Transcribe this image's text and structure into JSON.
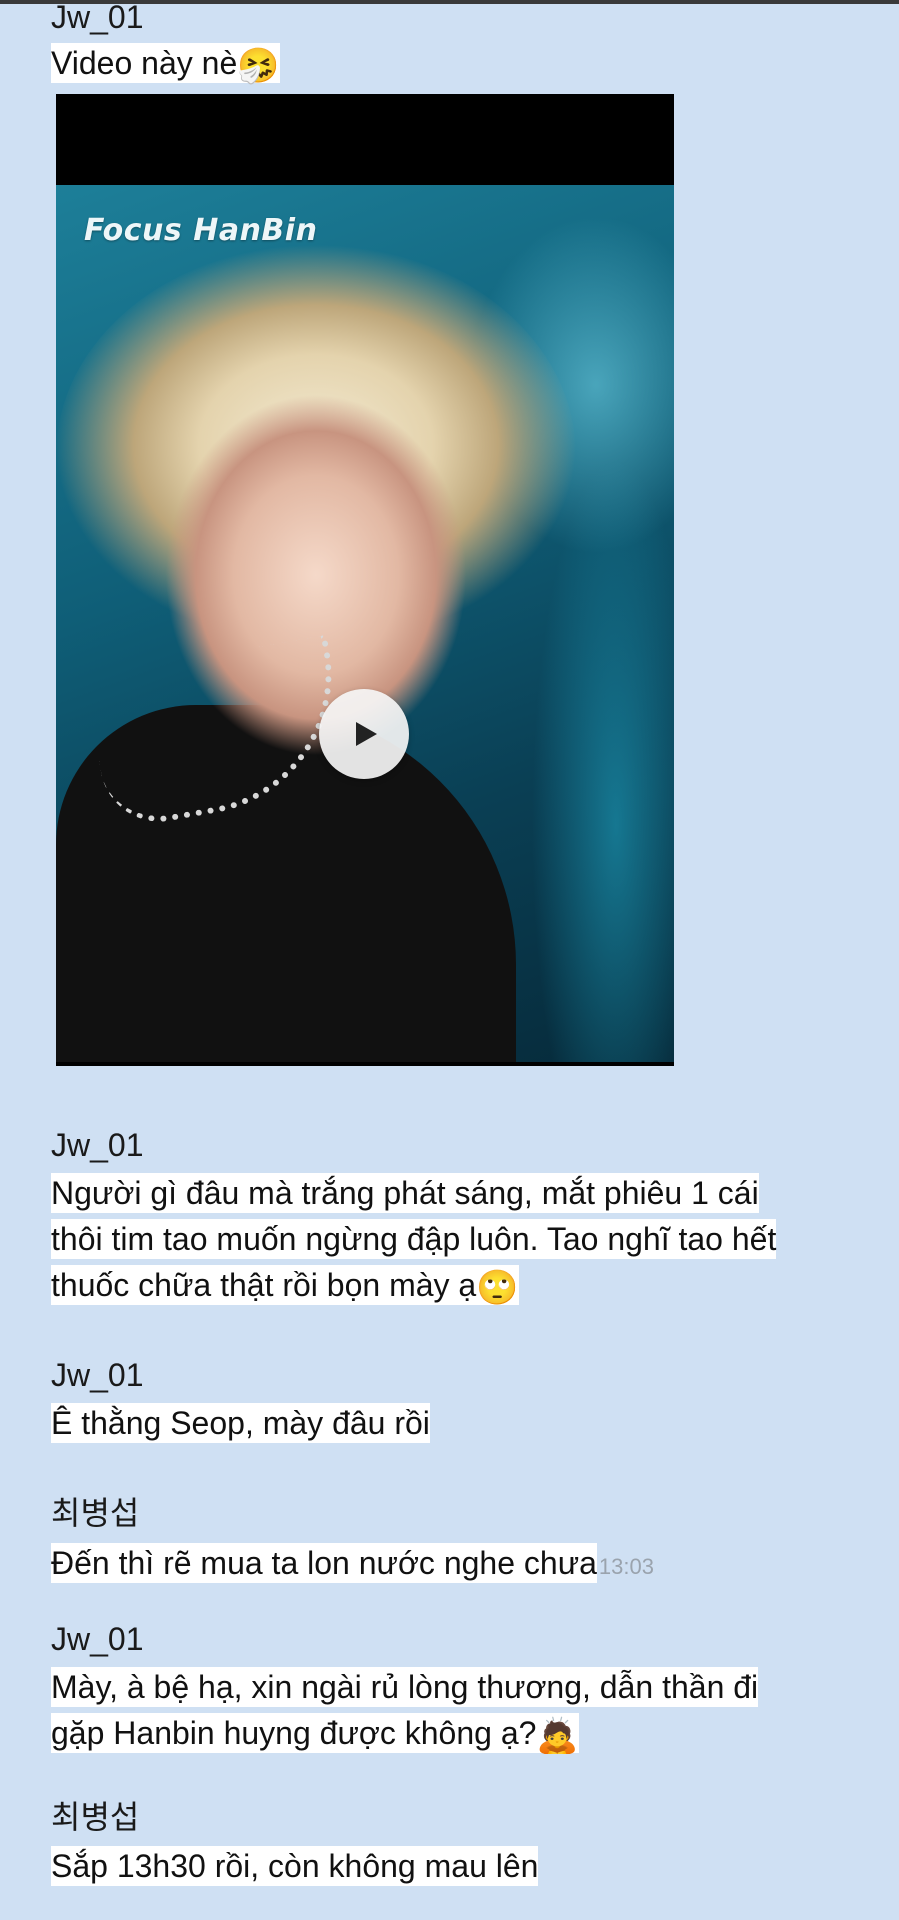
{
  "messages": [
    {
      "sender": "Jw_01",
      "text": "Video này nè",
      "emoji": "🤧"
    },
    {
      "video": {
        "overlay_text": "Focus HanBin",
        "play_icon": "play-icon"
      }
    },
    {
      "sender": "Jw_01",
      "lines": [
        "Người gì đâu mà trắng phát sáng, mắt phiêu 1 cái",
        "thôi tim tao muốn ngừng đập luôn. Tao nghĩ tao hết",
        "thuốc chữa thật rồi bọn mày ạ"
      ],
      "emoji": "🙄"
    },
    {
      "sender": "Jw_01",
      "text": "Ê thằng Seop, mày đâu rồi"
    },
    {
      "sender": "최병섭",
      "text": "Đến thì rẽ mua ta lon nước nghe chưa",
      "time": "13:03"
    },
    {
      "sender": "Jw_01",
      "lines": [
        "Mày, à bệ hạ, xin ngài rủ lòng thương, dẫn thần đi",
        "gặp Hanbin huyng được không ạ?"
      ],
      "emoji": "🙇"
    },
    {
      "sender": "최병섭",
      "text": "Sắp 13h30 rồi, còn không mau lên"
    }
  ],
  "colors": {
    "background": "#cfe0f3",
    "text_highlight": "#ffffff",
    "timestamp": "#9aa3ad"
  }
}
